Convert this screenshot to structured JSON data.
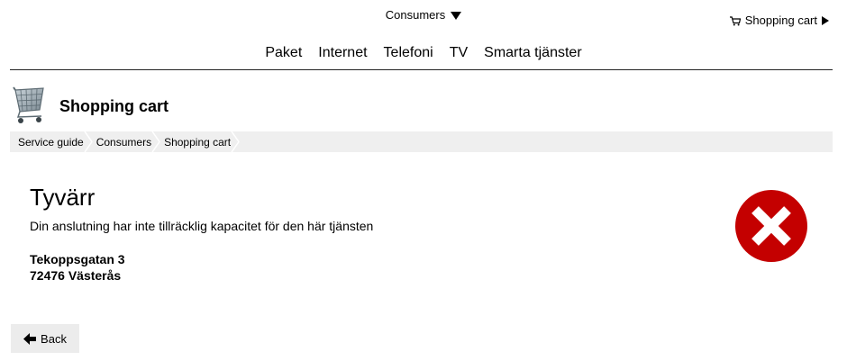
{
  "header": {
    "segment_label": "Consumers",
    "cart_label": "Shopping cart"
  },
  "nav": {
    "items": [
      {
        "label": "Paket"
      },
      {
        "label": "Internet"
      },
      {
        "label": "Telefoni"
      },
      {
        "label": "TV"
      },
      {
        "label": "Smarta tjänster"
      }
    ]
  },
  "page": {
    "title": "Shopping cart"
  },
  "breadcrumb": {
    "items": [
      {
        "label": "Service guide"
      },
      {
        "label": "Consumers"
      },
      {
        "label": "Shopping cart"
      }
    ]
  },
  "message": {
    "title": "Tyvärr",
    "text": "Din anslutning har inte tillräcklig kapacitet för den här tjänsten",
    "address_line1": "Tekoppsgatan 3",
    "address_line2": "72476 Västerås"
  },
  "actions": {
    "back_label": "Back"
  },
  "colors": {
    "error_red": "#c40000",
    "breadcrumb_bg": "#efefef",
    "button_bg": "#ececec"
  },
  "icons": {
    "cart": "cart-icon",
    "error": "error-x-icon",
    "back": "back-arrow-icon"
  }
}
